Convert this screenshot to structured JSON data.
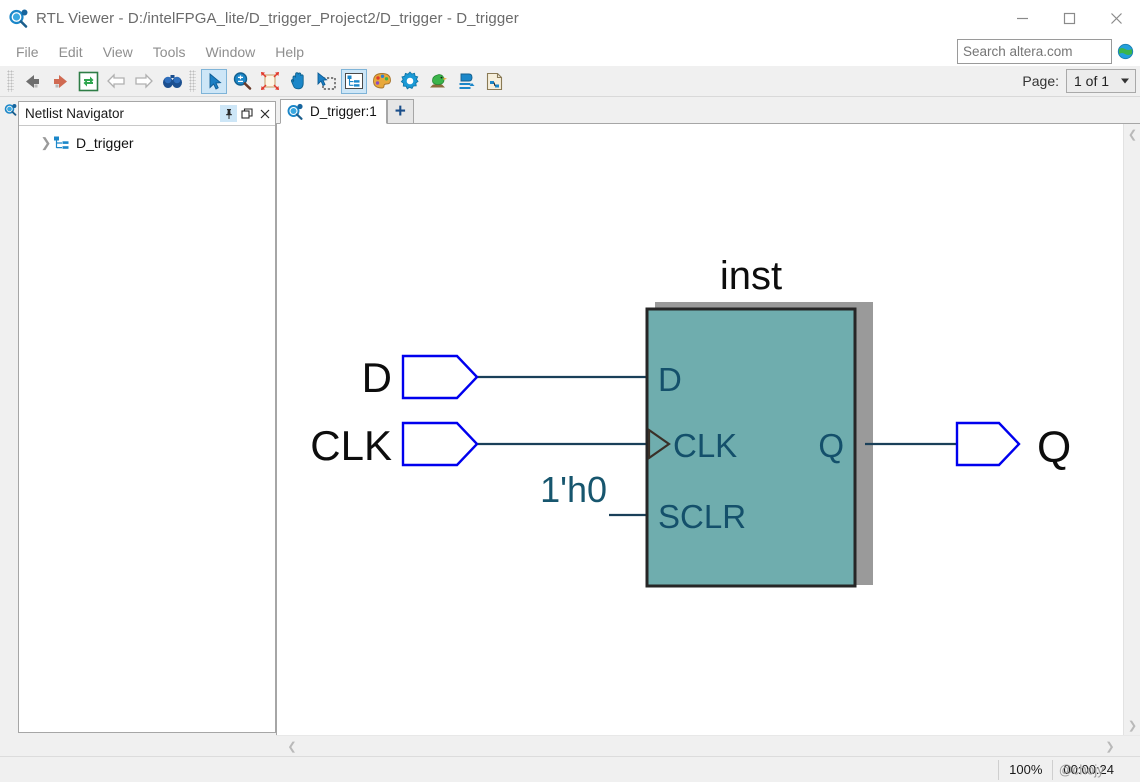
{
  "window": {
    "title": "RTL Viewer - D:/intelFPGA_lite/D_trigger_Project2/D_trigger - D_trigger",
    "app_icon": "rtl-viewer-icon",
    "minimize_label": "Minimize",
    "maximize_label": "Maximize",
    "close_label": "Close"
  },
  "menubar": {
    "items": [
      {
        "label": "File"
      },
      {
        "label": "Edit"
      },
      {
        "label": "View"
      },
      {
        "label": "Tools"
      },
      {
        "label": "Window"
      },
      {
        "label": "Help"
      }
    ]
  },
  "search": {
    "placeholder": "Search altera.com",
    "value": "",
    "icon": "globe-icon"
  },
  "toolbar": {
    "groups": [
      {
        "buttons": [
          {
            "name": "back-icon",
            "title": "Back"
          },
          {
            "name": "forward-icon",
            "title": "Forward"
          },
          {
            "name": "refresh-icon",
            "title": "Refresh"
          },
          {
            "name": "previous-page-icon",
            "title": "Previous Page"
          },
          {
            "name": "next-page-icon",
            "title": "Next Page"
          },
          {
            "name": "find-icon",
            "title": "Find"
          }
        ]
      },
      {
        "buttons": [
          {
            "name": "select-tool-icon",
            "title": "Selection Tool",
            "active": true
          },
          {
            "name": "zoom-tool-icon",
            "title": "Zoom Tool"
          },
          {
            "name": "fit-in-window-icon",
            "title": "Fit in Window"
          },
          {
            "name": "hand-tool-icon",
            "title": "Hand Tool"
          },
          {
            "name": "area-select-icon",
            "title": "Area Selection Tool"
          },
          {
            "name": "netlist-navigator-icon",
            "title": "Netlist Navigator",
            "active": true
          },
          {
            "name": "color-palette-icon",
            "title": "Color Settings"
          },
          {
            "name": "settings-gear-icon",
            "title": "Settings"
          },
          {
            "name": "bird-icon",
            "title": "Bird's Eye View"
          },
          {
            "name": "filter-icon",
            "title": "Filter"
          },
          {
            "name": "report-icon",
            "title": "Generate Report"
          }
        ]
      }
    ],
    "page_label": "Page:",
    "page_value": "1 of 1"
  },
  "netlist_navigator": {
    "title": "Netlist Navigator",
    "pin_icon": "pin-icon",
    "restore_icon": "restore-icon",
    "close_icon": "close-icon",
    "tree": [
      {
        "label": "D_trigger",
        "expanded": false,
        "arrow": "chevron-right-icon",
        "icon": "hierarchy-icon"
      }
    ]
  },
  "tabs": {
    "items": [
      {
        "label": "D_trigger:1",
        "icon": "rtl-viewer-icon",
        "active": true
      }
    ],
    "add_label": "+"
  },
  "schematic": {
    "instance_name": "inst",
    "block": {
      "fill": "#6fadae",
      "border": "#262626",
      "shadow": "#9a9a9a",
      "ports_left": [
        {
          "label": "D"
        },
        {
          "label": "CLK",
          "clock": true
        },
        {
          "label": "SCLR"
        }
      ],
      "ports_right": [
        {
          "label": "Q"
        }
      ]
    },
    "input_pins": [
      {
        "label": "D",
        "color": "#0000ee"
      },
      {
        "label": "CLK",
        "color": "#0000ee"
      }
    ],
    "output_pins": [
      {
        "label": "Q",
        "color": "#0000ee"
      }
    ],
    "constants": [
      {
        "label": "1'h0",
        "target": "SCLR",
        "color": "#17566e"
      }
    ],
    "wire_color": "#1a4059",
    "port_text_color": "#14506b"
  },
  "scrollbars": {
    "v_up": "chevron-up-icon",
    "v_down": "chevron-down-icon",
    "h_left": "chevron-left-icon",
    "h_right": "chevron-right-icon"
  },
  "statusbar": {
    "zoom": "100%",
    "time": "00:00:24",
    "watermark": "@chojy"
  }
}
